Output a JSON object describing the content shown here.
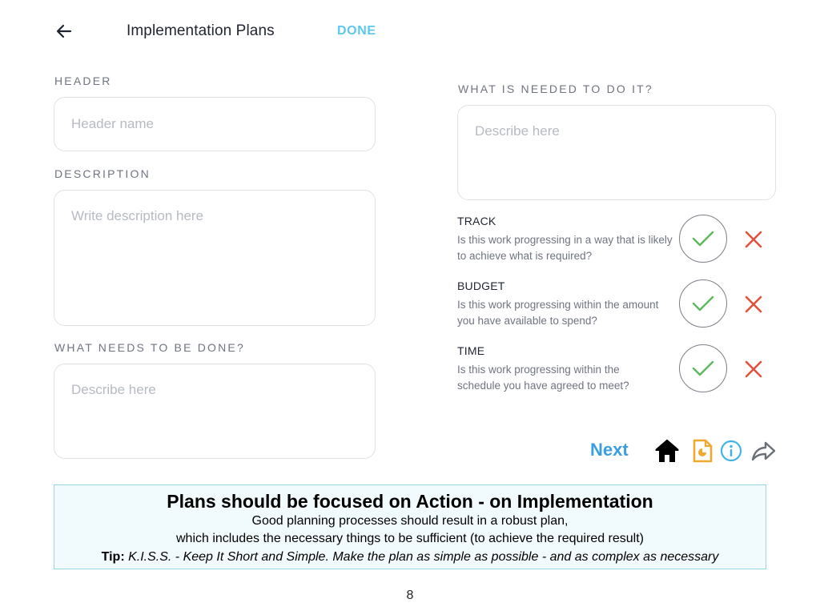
{
  "header": {
    "title": "Implementation Plans",
    "done_label": "DONE"
  },
  "form": {
    "header_label": "HEADER",
    "header_placeholder": "Header name",
    "description_label": "DESCRIPTION",
    "description_placeholder": "Write description here",
    "what_label": "WHAT NEEDS TO BE DONE?",
    "what_placeholder": "Describe here",
    "needed_label": "WHAT IS NEEDED TO DO IT?",
    "needed_placeholder": "Describe here"
  },
  "checklist": [
    {
      "title": "TRACK",
      "description": "Is this work progressing in a way that is likely to achieve what is required?"
    },
    {
      "title": "BUDGET",
      "description": "Is this work progressing within the amount you have available to spend?"
    },
    {
      "title": "TIME",
      "description": "Is this work progressing within the schedule you have agreed to meet?"
    }
  ],
  "nav": {
    "next_label": "Next",
    "icons": [
      "home-icon",
      "document-icon",
      "info-icon",
      "share-icon"
    ]
  },
  "tip": {
    "heading": "Plans should be focused on Action - on Implementation",
    "line1": "Good planning processes should result in a robust plan,",
    "line2": "which includes the necessary things to be sufficient (to achieve the required result)",
    "tip_prefix": "Tip:",
    "tip_text": "K.I.S.S. - Keep It Short and Simple. Make the plan as simple as possible - and as complex as necessary"
  },
  "page_number": "8",
  "colors": {
    "accent_done": "#5cc8f0",
    "accent_next": "#3b9ee0",
    "check_green": "#5cb85c",
    "cross_red": "#e0533d",
    "document_orange": "#f0a82e",
    "tip_border": "#9ad4e6"
  }
}
